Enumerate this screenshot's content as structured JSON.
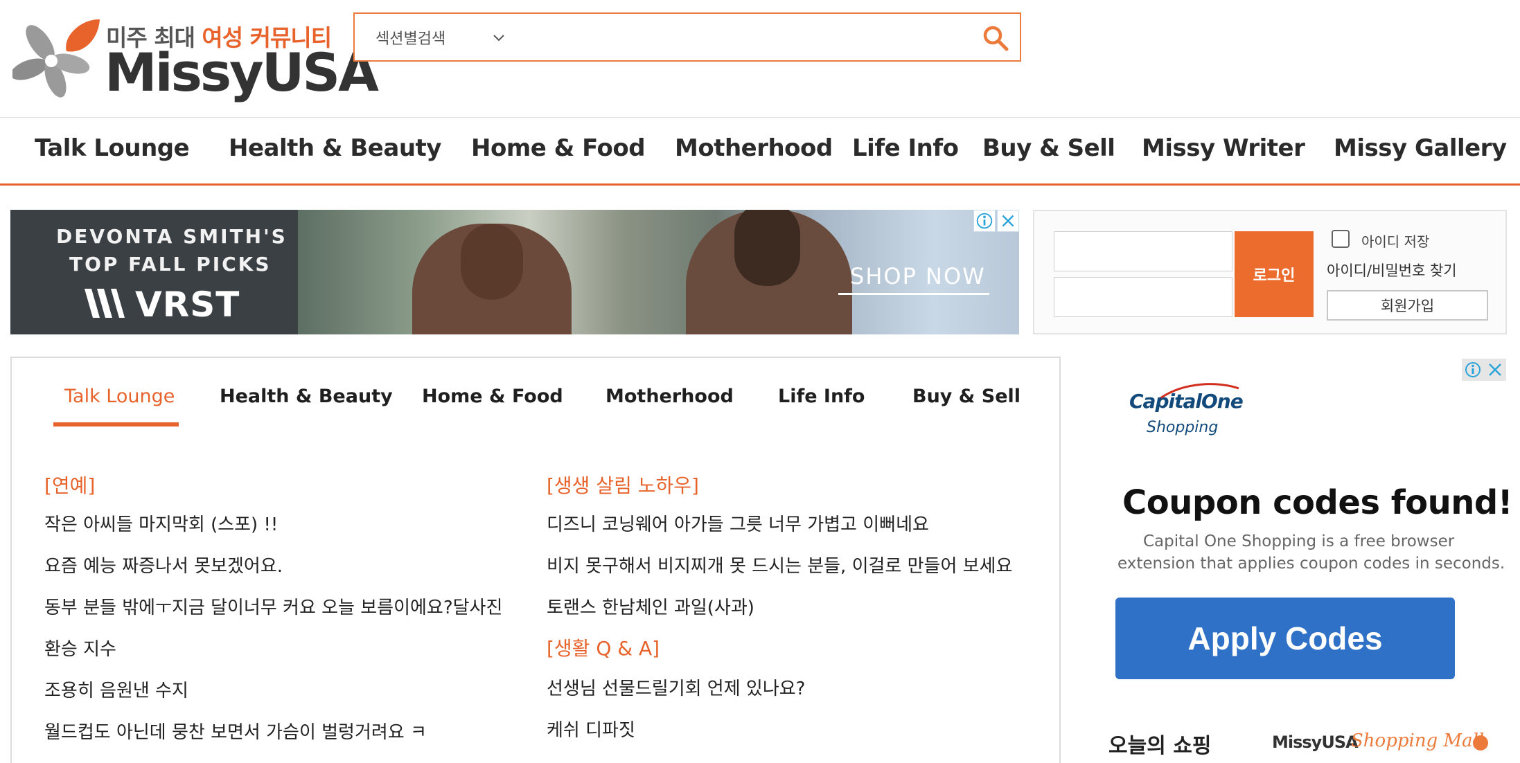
{
  "header": {
    "logo": {
      "tagline_gray": "미주 최대 ",
      "tagline_orange": "여성 커뮤니티",
      "brand": "MissyUSA"
    },
    "search": {
      "section_label": "섹션별검색",
      "input_value": "",
      "placeholder": ""
    }
  },
  "main_nav": [
    "Talk Lounge",
    "Health & Beauty",
    "Home & Food",
    "Motherhood",
    "Life Info",
    "Buy & Sell",
    "Missy Writer",
    "Missy Gallery"
  ],
  "ad_banner": {
    "line1": "DEVONTA SMITH'S",
    "line2": "TOP FALL PICKS",
    "brand": "VRST",
    "cta": "SHOP NOW"
  },
  "login": {
    "button": "로그인",
    "save_id": "아이디 저장",
    "find": "아이디/비밀번호 찾기",
    "signup": "회원가입"
  },
  "content": {
    "tabs": [
      "Talk Lounge",
      "Health & Beauty",
      "Home & Food",
      "Motherhood",
      "Life Info",
      "Buy & Sell"
    ],
    "active_tab": "Talk Lounge",
    "left": {
      "heading": "[연예]",
      "posts": [
        "작은 아씨들 마지막회 (스포) !!",
        "요즘 예능 짜증나서 못보겠어요.",
        "동부 분들 밖에ㅜ지금 달이너무 커요 오늘 보름이에요?달사진",
        "환승 지수",
        "조용히 음원낸 수지",
        "월드컵도 아닌데 뭉찬 보면서 가슴이 벌렁거려요 ㅋ"
      ]
    },
    "right": {
      "heading1": "[생생 살림 노하우]",
      "posts1": [
        "디즈니 코닝웨어 아가들 그릇 너무 가볍고 이뻐네요",
        "비지 못구해서 비지찌개 못 드시는 분들, 이걸로 만들어 보세요",
        "토랜스 한남체인 과일(사과)"
      ],
      "heading2": "[생활 Q & A]",
      "posts2": [
        "선생님 선물드릴기회 언제 있나요?",
        "케쉬 디파짓"
      ]
    }
  },
  "right_ad": {
    "logo_top": "CapitalOne",
    "logo_bottom": "Shopping",
    "headline": "Coupon codes found!",
    "desc1": "Capital One Shopping is a free browser",
    "desc2": "extension that applies coupon codes in seconds.",
    "cta": "Apply Codes"
  },
  "shopping": {
    "title": "오늘의 쇼핑",
    "mall_name": "MissyUSA",
    "mall_script": "Shopping Mall"
  },
  "colors": {
    "accent": "#e8632c",
    "capital_one_blue": "#2f71c6"
  }
}
